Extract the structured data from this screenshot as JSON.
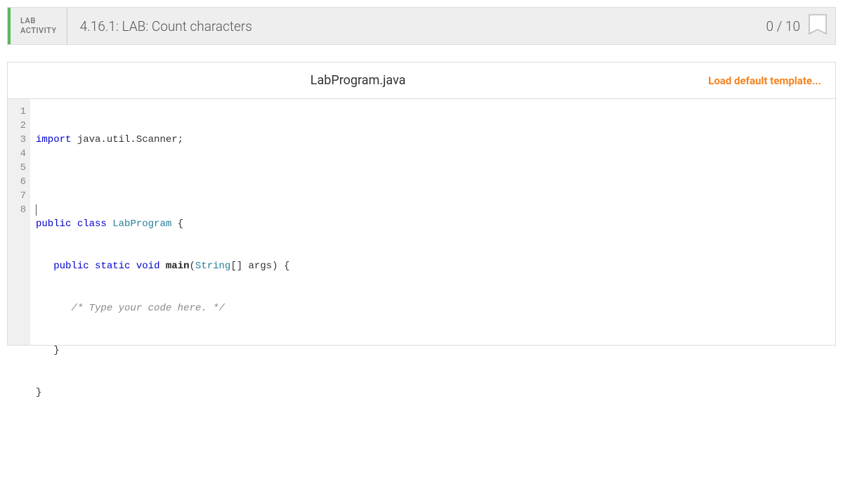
{
  "header": {
    "label_line1": "LAB",
    "label_line2": "ACTIVITY",
    "title": "4.16.1: LAB: Count characters",
    "score_current": "0",
    "score_separator": "/",
    "score_total": "10"
  },
  "editor": {
    "filename": "LabProgram.java",
    "load_template": "Load default template...",
    "gutter": [
      "1",
      "2",
      "3",
      "4",
      "5",
      "6",
      "7",
      "8"
    ],
    "code": {
      "l1_kw": "import",
      "l1_rest": " java.util.Scanner;",
      "l3_kw1": "public",
      "l3_kw2": "class",
      "l3_cls": "LabProgram",
      "l3_brace": " {",
      "l4_indent": "   ",
      "l4_kw1": "public",
      "l4_kw2": "static",
      "l4_kw3": "void",
      "l4_mtd": "main",
      "l4_paren": "(",
      "l4_type": "String",
      "l4_rest": "[] args) {",
      "l5_indent": "      ",
      "l5_comment": "/* Type your code here. */",
      "l6_indent": "   ",
      "l6_brace": "}",
      "l7_brace": "}"
    }
  }
}
